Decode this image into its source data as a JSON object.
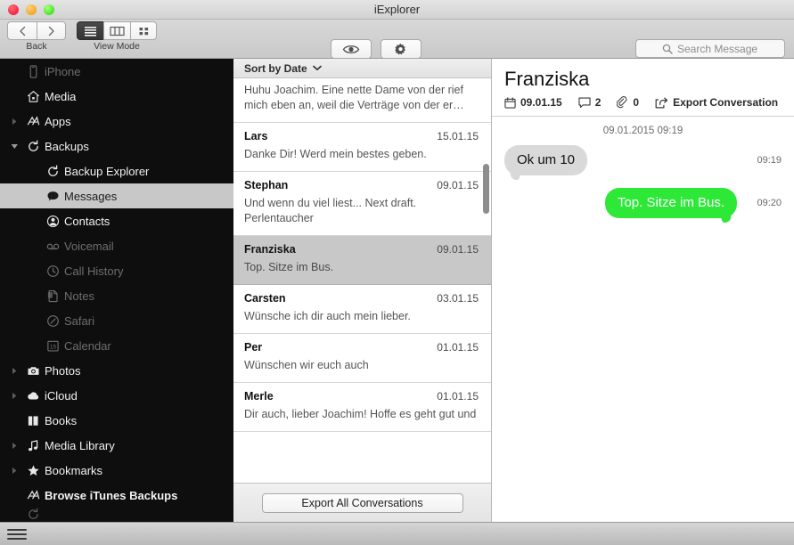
{
  "window": {
    "title": "iExplorer"
  },
  "toolbar": {
    "back_label": "Back",
    "view_mode_label": "View Mode",
    "quick_look_label": "Quick Look",
    "action_label": "Action",
    "search_label": "Search",
    "search_placeholder": "Search Message",
    "search_value": ""
  },
  "sidebar": {
    "items": [
      {
        "label": "iPhone",
        "icon": "phone-icon",
        "level": 0,
        "state": "dim",
        "disclosure": "none"
      },
      {
        "label": "Media",
        "icon": "home-icon",
        "level": 0,
        "state": "enabled",
        "disclosure": "none"
      },
      {
        "label": "Apps",
        "icon": "apps-icon",
        "level": 0,
        "state": "enabled",
        "disclosure": "collapsed"
      },
      {
        "label": "Backups",
        "icon": "backup-icon",
        "level": 0,
        "state": "enabled",
        "disclosure": "expanded"
      },
      {
        "label": "Backup Explorer",
        "icon": "backup-icon",
        "level": 1,
        "state": "enabled",
        "disclosure": "none"
      },
      {
        "label": "Messages",
        "icon": "message-icon",
        "level": 1,
        "state": "selected",
        "disclosure": "none"
      },
      {
        "label": "Contacts",
        "icon": "contacts-icon",
        "level": 1,
        "state": "enabled",
        "disclosure": "none"
      },
      {
        "label": "Voicemail",
        "icon": "voicemail-icon",
        "level": 1,
        "state": "dim",
        "disclosure": "none"
      },
      {
        "label": "Call History",
        "icon": "clock-icon",
        "level": 1,
        "state": "dim",
        "disclosure": "none"
      },
      {
        "label": "Notes",
        "icon": "notes-icon",
        "level": 1,
        "state": "dim",
        "disclosure": "none"
      },
      {
        "label": "Safari",
        "icon": "safari-icon",
        "level": 1,
        "state": "dim",
        "disclosure": "none"
      },
      {
        "label": "Calendar",
        "icon": "calendar-icon",
        "level": 1,
        "state": "dim",
        "disclosure": "none"
      },
      {
        "label": "Photos",
        "icon": "camera-icon",
        "level": 0,
        "state": "enabled",
        "disclosure": "collapsed"
      },
      {
        "label": "iCloud",
        "icon": "cloud-icon",
        "level": 0,
        "state": "enabled",
        "disclosure": "collapsed"
      },
      {
        "label": "Books",
        "icon": "books-icon",
        "level": 0,
        "state": "enabled",
        "disclosure": "none"
      },
      {
        "label": "Media Library",
        "icon": "music-note-icon",
        "level": 0,
        "state": "enabled",
        "disclosure": "collapsed"
      },
      {
        "label": "Bookmarks",
        "icon": "star-icon",
        "level": 0,
        "state": "enabled",
        "disclosure": "collapsed"
      },
      {
        "label": "Browse iTunes Backups",
        "icon": "apps-icon",
        "level": 0,
        "state": "bold",
        "disclosure": "none"
      }
    ]
  },
  "message_list": {
    "sort_label": "Sort by Date",
    "export_all_label": "Export All Conversations",
    "rows": [
      {
        "name": "",
        "date": "",
        "preview": "Huhu Joachim. Eine nette Dame von der rief mich eben an, weil die Verträge von der er…",
        "selected": false,
        "partial": true
      },
      {
        "name": "Lars",
        "date": "15.01.15",
        "preview": "Danke Dir! Werd mein bestes geben.",
        "selected": false,
        "partial": false
      },
      {
        "name": "Stephan",
        "date": "09.01.15",
        "preview": "Und wenn du viel liest... Next draft. Perlentaucher",
        "selected": false,
        "partial": false
      },
      {
        "name": "Franziska",
        "date": "09.01.15",
        "preview": "Top. Sitze im Bus.",
        "selected": true,
        "partial": false
      },
      {
        "name": "Carsten",
        "date": "03.01.15",
        "preview": "Wünsche ich dir auch mein lieber.",
        "selected": false,
        "partial": false
      },
      {
        "name": "Per",
        "date": "01.01.15",
        "preview": "Wünschen wir euch auch",
        "selected": false,
        "partial": false
      },
      {
        "name": "Merle",
        "date": "01.01.15",
        "preview": "Dir auch, lieber Joachim! Hoffe es geht gut und",
        "selected": false,
        "partial": false
      }
    ]
  },
  "detail": {
    "title": "Franziska",
    "date": "09.01.15",
    "message_count": "2",
    "attachment_count": "0",
    "export_label": "Export Conversation",
    "conversation_date": "09.01.2015 09:19",
    "bubbles": [
      {
        "text": "Ok um 10",
        "time": "09:19",
        "direction": "in"
      },
      {
        "text": "Top. Sitze im Bus.",
        "time": "09:20",
        "direction": "out"
      }
    ]
  },
  "colors": {
    "accent_green": "#2ee838",
    "incoming_gray": "#d9d9da",
    "selection_gray": "#c8c8c8"
  }
}
